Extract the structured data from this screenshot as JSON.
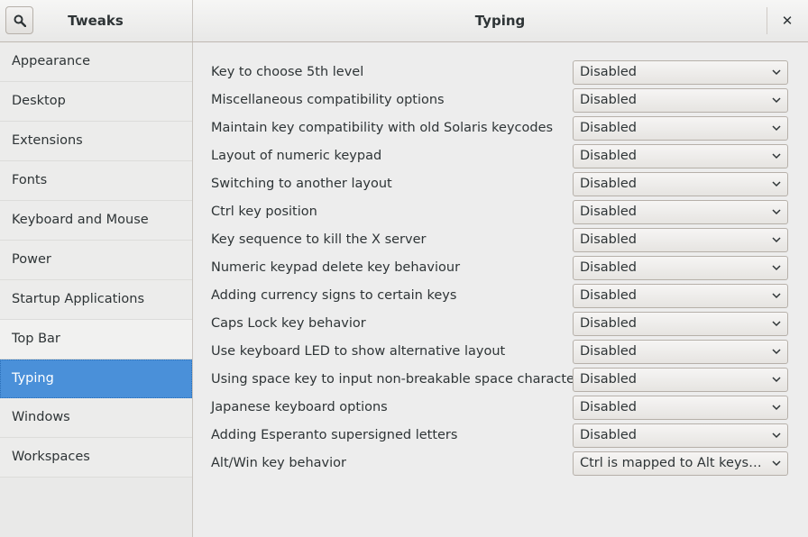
{
  "header": {
    "app_title": "Tweaks",
    "page_title": "Typing",
    "search_icon": "search-icon",
    "close_icon": "close-icon",
    "close_glyph": "✕"
  },
  "sidebar": {
    "items": [
      {
        "label": "Appearance"
      },
      {
        "label": "Desktop"
      },
      {
        "label": "Extensions"
      },
      {
        "label": "Fonts"
      },
      {
        "label": "Keyboard and Mouse"
      },
      {
        "label": "Power"
      },
      {
        "label": "Startup Applications"
      },
      {
        "label": "Top Bar"
      },
      {
        "label": "Typing",
        "selected": true
      },
      {
        "label": "Windows"
      },
      {
        "label": "Workspaces"
      }
    ]
  },
  "main": {
    "settings": [
      {
        "label": "Key to choose 5th level",
        "value": "Disabled"
      },
      {
        "label": "Miscellaneous compatibility options",
        "value": "Disabled"
      },
      {
        "label": "Maintain key compatibility with old Solaris keycodes",
        "value": "Disabled"
      },
      {
        "label": "Layout of numeric keypad",
        "value": "Disabled"
      },
      {
        "label": "Switching to another layout",
        "value": "Disabled"
      },
      {
        "label": "Ctrl key position",
        "value": "Disabled"
      },
      {
        "label": "Key sequence to kill the X server",
        "value": "Disabled"
      },
      {
        "label": "Numeric keypad delete key behaviour",
        "value": "Disabled"
      },
      {
        "label": "Adding currency signs to certain keys",
        "value": "Disabled"
      },
      {
        "label": "Caps Lock key behavior",
        "value": "Disabled"
      },
      {
        "label": "Use keyboard LED to show alternative layout",
        "value": "Disabled"
      },
      {
        "label": "Using space key to input non-breakable space character",
        "value": "Disabled"
      },
      {
        "label": "Japanese keyboard options",
        "value": "Disabled"
      },
      {
        "label": "Adding Esperanto supersigned letters",
        "value": "Disabled"
      },
      {
        "label": "Alt/Win key behavior",
        "value": "Ctrl is mapped to Alt keys, Alt …"
      }
    ]
  },
  "colors": {
    "selected_bg": "#4a90d9",
    "text": "#2e3436",
    "window_bg": "#ededed"
  }
}
